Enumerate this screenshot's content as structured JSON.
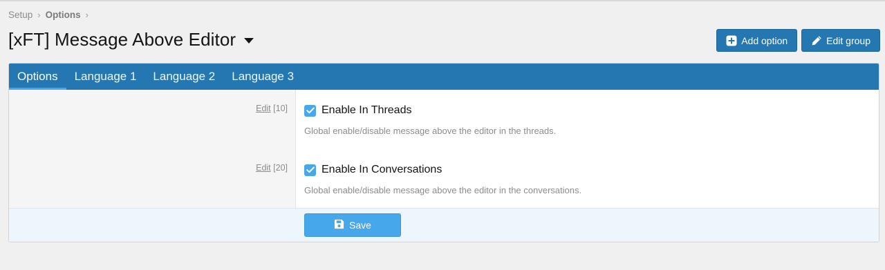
{
  "breadcrumb": {
    "items": [
      {
        "label": "Setup"
      },
      {
        "label": "Options"
      }
    ]
  },
  "page": {
    "title": "[xFT] Message Above Editor"
  },
  "header_buttons": {
    "add_option": "Add option",
    "edit_group": "Edit group"
  },
  "tabs": [
    {
      "label": "Options",
      "active": true
    },
    {
      "label": "Language 1",
      "active": false
    },
    {
      "label": "Language 2",
      "active": false
    },
    {
      "label": "Language 3",
      "active": false
    }
  ],
  "options": [
    {
      "edit_label": "Edit",
      "order": "[10]",
      "label": "Enable In Threads",
      "checked": true,
      "hint": "Global enable/disable message above the editor in the threads."
    },
    {
      "edit_label": "Edit",
      "order": "[20]",
      "label": "Enable In Conversations",
      "checked": true,
      "hint": "Global enable/disable message above the editor in the conversations."
    }
  ],
  "footer": {
    "save_label": "Save"
  },
  "colors": {
    "primary": "#2577b1",
    "accent": "#47a7eb",
    "page_bg": "#f0f0f0",
    "muted_text": "#8c8c8c"
  },
  "icons": {
    "add_option": "plus-square-icon",
    "edit_group": "pencil-icon",
    "save": "floppy-disk-icon",
    "title_menu": "caret-down-icon",
    "checkbox": "check-icon"
  }
}
